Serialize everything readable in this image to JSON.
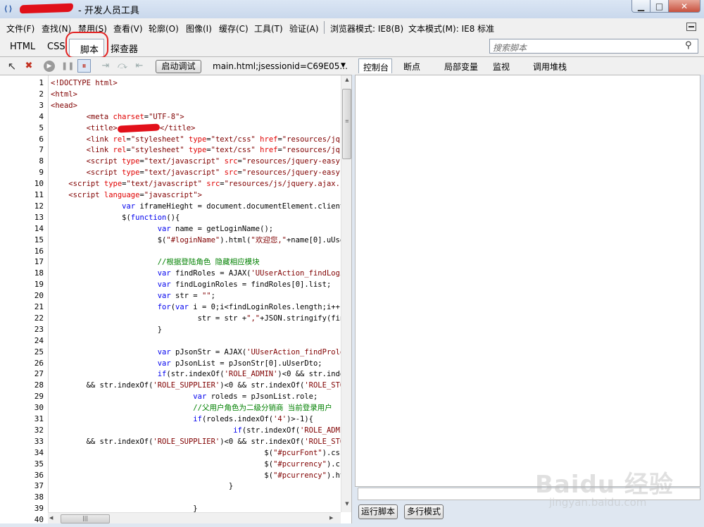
{
  "title_bar": {
    "title": "- 开发人员工具",
    "icon": "ie-devtools-icon",
    "minimize": "▁",
    "maximize": "□",
    "close": "✕"
  },
  "menu": {
    "items": [
      "文件(F)",
      "查找(N)",
      "禁用(S)",
      "查看(V)",
      "轮廓(O)",
      "图像(I)",
      "缓存(C)",
      "工具(T)",
      "验证(A)"
    ],
    "browser_mode": "浏览器模式: IE8(B)",
    "document_mode": "文本模式(M): IE8 标准"
  },
  "tabs": [
    "HTML",
    "CSS",
    "脚本",
    "探查器"
  ],
  "active_tab": "脚本",
  "search": {
    "placeholder": "搜索脚本",
    "icon": "search-icon"
  },
  "toolbar": {
    "start_debug": "启动调试",
    "file": "main.html;jsessionid=C69E05...",
    "file_arrow": "▼"
  },
  "right_tabs": [
    "控制台",
    "断点",
    "局部变量",
    "监视",
    "调用堆栈"
  ],
  "active_right_tab": "控制台",
  "code": {
    "line_numbers": [
      "1",
      "2",
      "3",
      "4",
      "5",
      "6",
      "7",
      "8",
      "9",
      "10",
      "11",
      "12",
      "13",
      "14",
      "15",
      "16",
      "17",
      "18",
      "19",
      "20",
      "21",
      "22",
      "23",
      "24",
      "25",
      "26",
      "27",
      "28",
      "29",
      "30",
      "31",
      "32",
      "33",
      "34",
      "35",
      "36",
      "37",
      "38",
      "39",
      "40"
    ]
  },
  "console": {
    "run_script": "运行脚本",
    "multiline": "多行模式"
  },
  "watermark": {
    "logo": "Baidu 经验",
    "url": "jingyan.baidu.com"
  },
  "colors": {
    "accent_red": "#e32222",
    "keyword": "#0000ee",
    "tag": "#800000",
    "attr": "#e00000",
    "comment": "#008000"
  }
}
